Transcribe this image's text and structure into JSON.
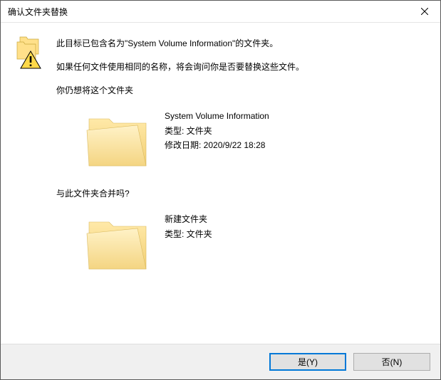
{
  "window": {
    "title": "确认文件夹替换"
  },
  "message": {
    "line1": "此目标已包含名为\"System Volume Information\"的文件夹。",
    "line2": "如果任何文件使用相同的名称，将会询问你是否要替换这些文件。"
  },
  "source": {
    "prompt": "你仍想将这个文件夹",
    "name": "System Volume Information",
    "type_label": "类型: 文件夹",
    "modified_label": "修改日期: 2020/9/22 18:28"
  },
  "destination": {
    "prompt": "与此文件夹合并吗?",
    "name": "新建文件夹",
    "type_label": "类型: 文件夹"
  },
  "buttons": {
    "yes": "是(Y)",
    "no": "否(N)"
  }
}
